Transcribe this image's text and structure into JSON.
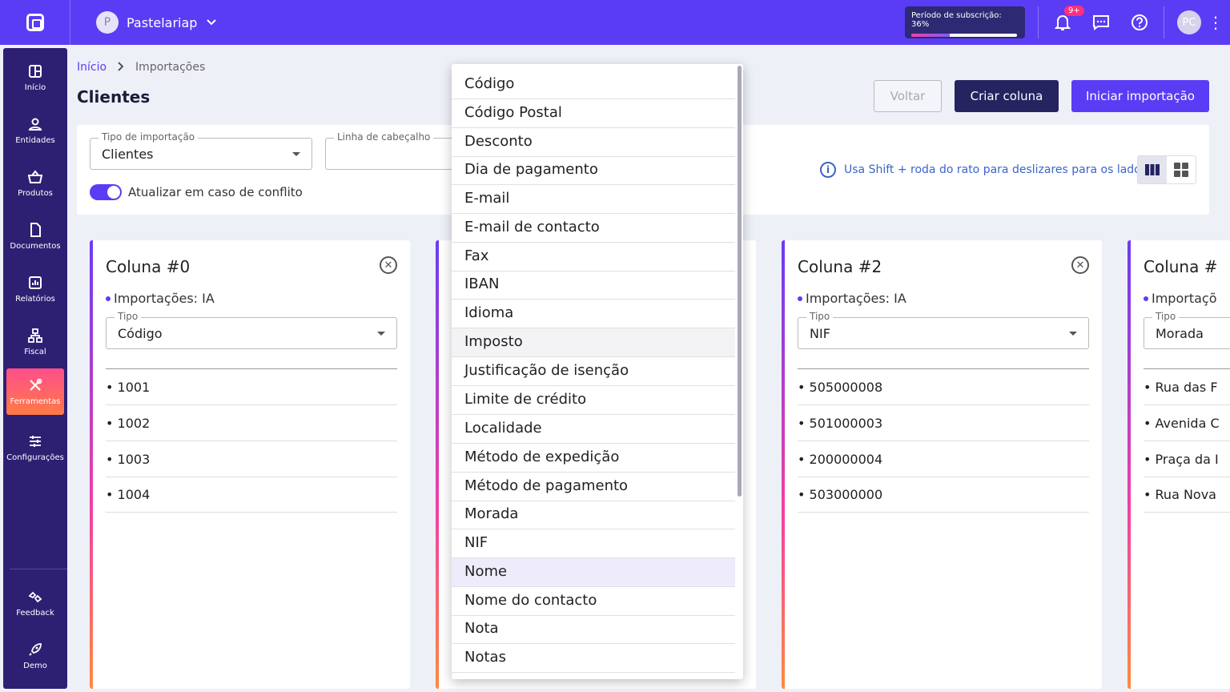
{
  "topbar": {
    "company_initial": "P",
    "company_name": "Pastelariap",
    "subscription_label": "Período de subscrição: 36%",
    "subscription_progress": 0.36,
    "notifications_badge": "9+",
    "user_initials": "PC"
  },
  "sidebar": {
    "items": [
      {
        "label": "Início",
        "icon": "dashboard-icon"
      },
      {
        "label": "Entidades",
        "icon": "person-icon"
      },
      {
        "label": "Produtos",
        "icon": "basket-icon"
      },
      {
        "label": "Documentos",
        "icon": "document-icon"
      },
      {
        "label": "Relatórios",
        "icon": "chart-icon"
      },
      {
        "label": "Fiscal",
        "icon": "hierarchy-icon"
      },
      {
        "label": "Ferramentas",
        "icon": "tools-icon"
      },
      {
        "label": "Configurações",
        "icon": "sliders-icon"
      }
    ],
    "bottom": [
      {
        "label": "Feedback",
        "icon": "feedback-icon"
      },
      {
        "label": "Demo",
        "icon": "rocket-icon"
      }
    ]
  },
  "breadcrumb": {
    "home": "Início",
    "current": "Importações"
  },
  "page_title": "Clientes",
  "actions": {
    "back": "Voltar",
    "create_column": "Criar coluna",
    "start_import": "Iniciar importação"
  },
  "settings": {
    "import_type_label": "Tipo de importação",
    "import_type_value": "Clientes",
    "header_line_label": "Linha de cabeçalho",
    "conflict_toggle_label": "Atualizar em caso de conflito",
    "hint": "Usa Shift + roda do rato para deslizares para os lados"
  },
  "columns": [
    {
      "title": "Coluna #0",
      "imports": "Importações: IA",
      "type_label": "Tipo",
      "type_value": "Código",
      "rows": [
        "• 1001",
        "• 1002",
        "• 1003",
        "• 1004"
      ]
    },
    {
      "title": "Coluna #2",
      "imports": "Importações: IA",
      "type_label": "Tipo",
      "type_value": "NIF",
      "rows": [
        "• 505000008",
        "• 501000003",
        "• 200000004",
        "• 503000000"
      ]
    },
    {
      "title": "Coluna #",
      "imports": "Importaçõ",
      "type_label": "Tipo",
      "type_value": "Morada",
      "rows": [
        "• Rua das F",
        "• Avenida C",
        "• Praça da I",
        "• Rua Nova"
      ]
    }
  ],
  "dropdown": {
    "options": [
      "Código",
      "Código Postal",
      "Desconto",
      "Dia de pagamento",
      "E-mail",
      "E-mail de contacto",
      "Fax",
      "IBAN",
      "Idioma",
      "Imposto",
      "Justificação de isenção",
      "Limite de crédito",
      "Localidade",
      "Método de expedição",
      "Método de pagamento",
      "Morada",
      "NIF",
      "Nome",
      "Nome do contacto",
      "Nota",
      "Notas"
    ],
    "hovered": "Imposto",
    "selected": "Nome"
  },
  "colors": {
    "accent": "#5b3cf5",
    "sidebar": "#2d2073",
    "dark_button": "#262361"
  }
}
